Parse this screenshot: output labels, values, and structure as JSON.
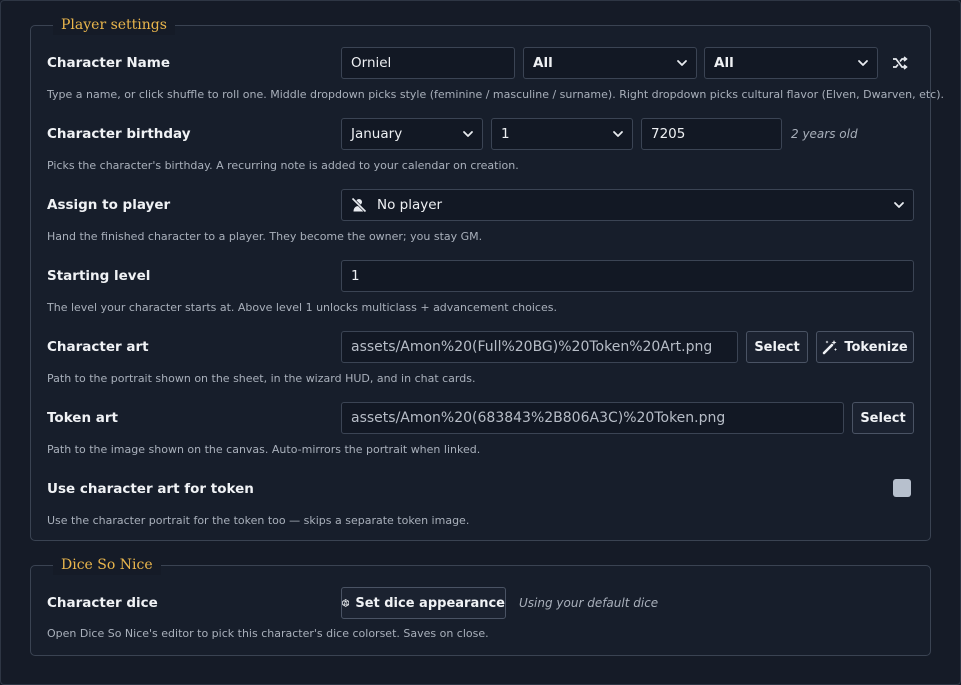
{
  "player_settings": {
    "legend": "Player settings",
    "character_name": {
      "label": "Character Name",
      "value": "Orniel",
      "style_option": "All",
      "culture_option": "All",
      "shuffle_icon": "shuffle-icon",
      "hint": "Type a name, or click shuffle to roll one. Middle dropdown picks style (feminine / masculine / surname). Right dropdown picks cultural flavor (Elven, Dwarven, etc)."
    },
    "birthday": {
      "label": "Character birthday",
      "month": "January",
      "day": "1",
      "year": "7205",
      "age_note": "2 years old",
      "hint": "Picks the character's birthday. A recurring note is added to your calendar on creation."
    },
    "assign": {
      "label": "Assign to player",
      "value": "No player",
      "icon": "user-slash-icon",
      "hint": "Hand the finished character to a player. They become the owner; you stay GM."
    },
    "level": {
      "label": "Starting level",
      "value": "1",
      "hint": "The level your character starts at. Above level 1 unlocks multiclass + advancement choices."
    },
    "character_art": {
      "label": "Character art",
      "path": "assets/Amon%20(Full%20BG)%20Token%20Art.png",
      "select_label": "Select",
      "tokenize_label": "Tokenize",
      "tokenize_icon": "magic-wand-icon",
      "hint": "Path to the portrait shown on the sheet, in the wizard HUD, and in chat cards."
    },
    "token_art": {
      "label": "Token art",
      "path": "assets/Amon%20(683843%2B806A3C)%20Token.png",
      "select_label": "Select",
      "hint": "Path to the image shown on the canvas. Auto-mirrors the portrait when linked."
    },
    "use_art": {
      "label": "Use character art for token",
      "checked": false,
      "hint": "Use the character portrait for the token too — skips a separate token image."
    }
  },
  "dice_so_nice": {
    "legend": "Dice So Nice",
    "label": "Character dice",
    "button_label": "Set dice appearance",
    "button_icon": "dice-d20-icon",
    "note": "Using your default dice",
    "hint": "Open Dice So Nice's editor to pick this character's dice colorset. Saves on close."
  },
  "colors": {
    "accent": "#e9b64c",
    "background": "#151b27",
    "input_background": "#121824",
    "border": "#3b4454",
    "checkbox": "#b7c0cd"
  }
}
